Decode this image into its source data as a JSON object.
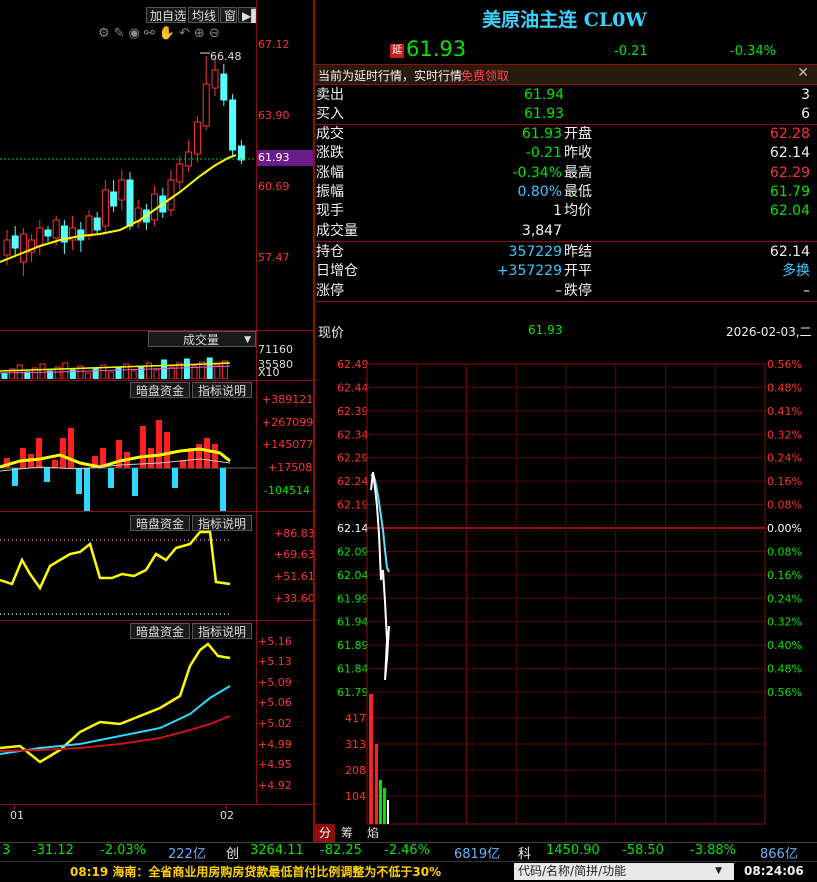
{
  "toolbar": {
    "add_watch": "加自选",
    "ma_line": "均线",
    "window": "窗"
  },
  "kline": {
    "price_labels": [
      "67.12",
      "63.90",
      "61.93",
      "60.69",
      "57.47"
    ],
    "high_marker": "66.48"
  },
  "volume": {
    "selector": "成交量",
    "labels": [
      "71160",
      "35580",
      "X10"
    ]
  },
  "indicator1": {
    "btn_a": "暗盘资金",
    "btn_b": "指标说明",
    "labels": [
      "+389121",
      "+267099",
      "+145077",
      "+17508",
      "-104514"
    ]
  },
  "indicator2": {
    "btn_a": "暗盘资金",
    "btn_b": "指标说明",
    "labels": [
      "+86.83",
      "+69.63",
      "+51.61",
      "+33.60"
    ]
  },
  "indicator3": {
    "btn_a": "暗盘资金",
    "btn_b": "指标说明",
    "labels": [
      "+5.16",
      "+5.13",
      "+5.09",
      "+5.06",
      "+5.02",
      "+4.99",
      "+4.95",
      "+4.92"
    ]
  },
  "xaxis": {
    "left": "01",
    "right": "02"
  },
  "quote": {
    "title": "美原油主连 CL0W",
    "delay_badge": "延",
    "price": "61.93",
    "change": "-0.21",
    "change_pct": "-0.34%",
    "notice": "当前为延时行情，实时行情",
    "notice_link": "免费领取"
  },
  "book": {
    "sell_label": "卖出",
    "sell_price": "61.94",
    "sell_vol": "3",
    "buy_label": "买入",
    "buy_price": "61.93",
    "buy_vol": "6"
  },
  "stats": [
    {
      "l1": "成交",
      "v1": "61.93",
      "l2": "开盘",
      "v2": "62.28",
      "c1": "grn",
      "c2": "red"
    },
    {
      "l1": "涨跌",
      "v1": "-0.21",
      "l2": "昨收",
      "v2": "62.14",
      "c1": "grn",
      "c2": "wht"
    },
    {
      "l1": "涨幅",
      "v1": "-0.34%",
      "l2": "最高",
      "v2": "62.29",
      "c1": "grn",
      "c2": "red"
    },
    {
      "l1": "振幅",
      "v1": "0.80%",
      "l2": "最低",
      "v2": "61.79",
      "c1": "cyan",
      "c2": "grn"
    },
    {
      "l1": "现手",
      "v1": "1",
      "l2": "均价",
      "v2": "62.04",
      "c1": "wht",
      "c2": "grn"
    },
    {
      "l1": "成交量",
      "v1": "3,847",
      "l2": "",
      "v2": "",
      "c1": "wht",
      "c2": "wht"
    }
  ],
  "stats2": [
    {
      "l1": "持仓",
      "v1": "357229",
      "l2": "昨结",
      "v2": "62.14",
      "c1": "cyan",
      "c2": "wht"
    },
    {
      "l1": "日增仓",
      "v1": "+357229",
      "l2": "开平",
      "v2": "多换",
      "c1": "cyan",
      "c2": "cyan"
    },
    {
      "l1": "涨停",
      "v1": "–",
      "l2": "跌停",
      "v2": "–",
      "c1": "wht",
      "c2": "wht"
    }
  ],
  "intraday": {
    "label": "现价",
    "price": "61.93",
    "date": "2026-02-03,二",
    "price_ticks": [
      "62.49",
      "62.44",
      "62.39",
      "62.34",
      "62.29",
      "62.24",
      "62.19",
      "62.14",
      "62.09",
      "62.04",
      "61.99",
      "61.94",
      "61.89",
      "61.84",
      "61.79"
    ],
    "pct_ticks": [
      "0.56%",
      "0.48%",
      "0.41%",
      "0.32%",
      "0.24%",
      "0.16%",
      "0.08%",
      "0.00%",
      "0.08%",
      "0.16%",
      "0.24%",
      "0.32%",
      "0.40%",
      "0.48%",
      "0.56%"
    ],
    "vol_ticks": [
      "417",
      "313",
      "208",
      "104"
    ],
    "tabs": [
      "分",
      "筹",
      "焰"
    ]
  },
  "ticker": {
    "a_val": "3",
    "a_chg": "-31.12",
    "a_pct": "-2.03%",
    "a_amt": "222亿",
    "b_name": "创",
    "b_val": "3264.11",
    "b_chg": "-82.25",
    "b_pct": "-2.46%",
    "b_amt": "6819亿",
    "c_name": "科",
    "c_val": "1450.90",
    "c_chg": "-58.50",
    "c_pct": "-3.88%",
    "c_amt": "866亿"
  },
  "news": {
    "text": "08:19 海南：全省商业用房购房贷款最低首付比例调整为不低于30%",
    "search_placeholder": "代码/名称/简拼/功能",
    "clock": "08:24:06"
  }
}
